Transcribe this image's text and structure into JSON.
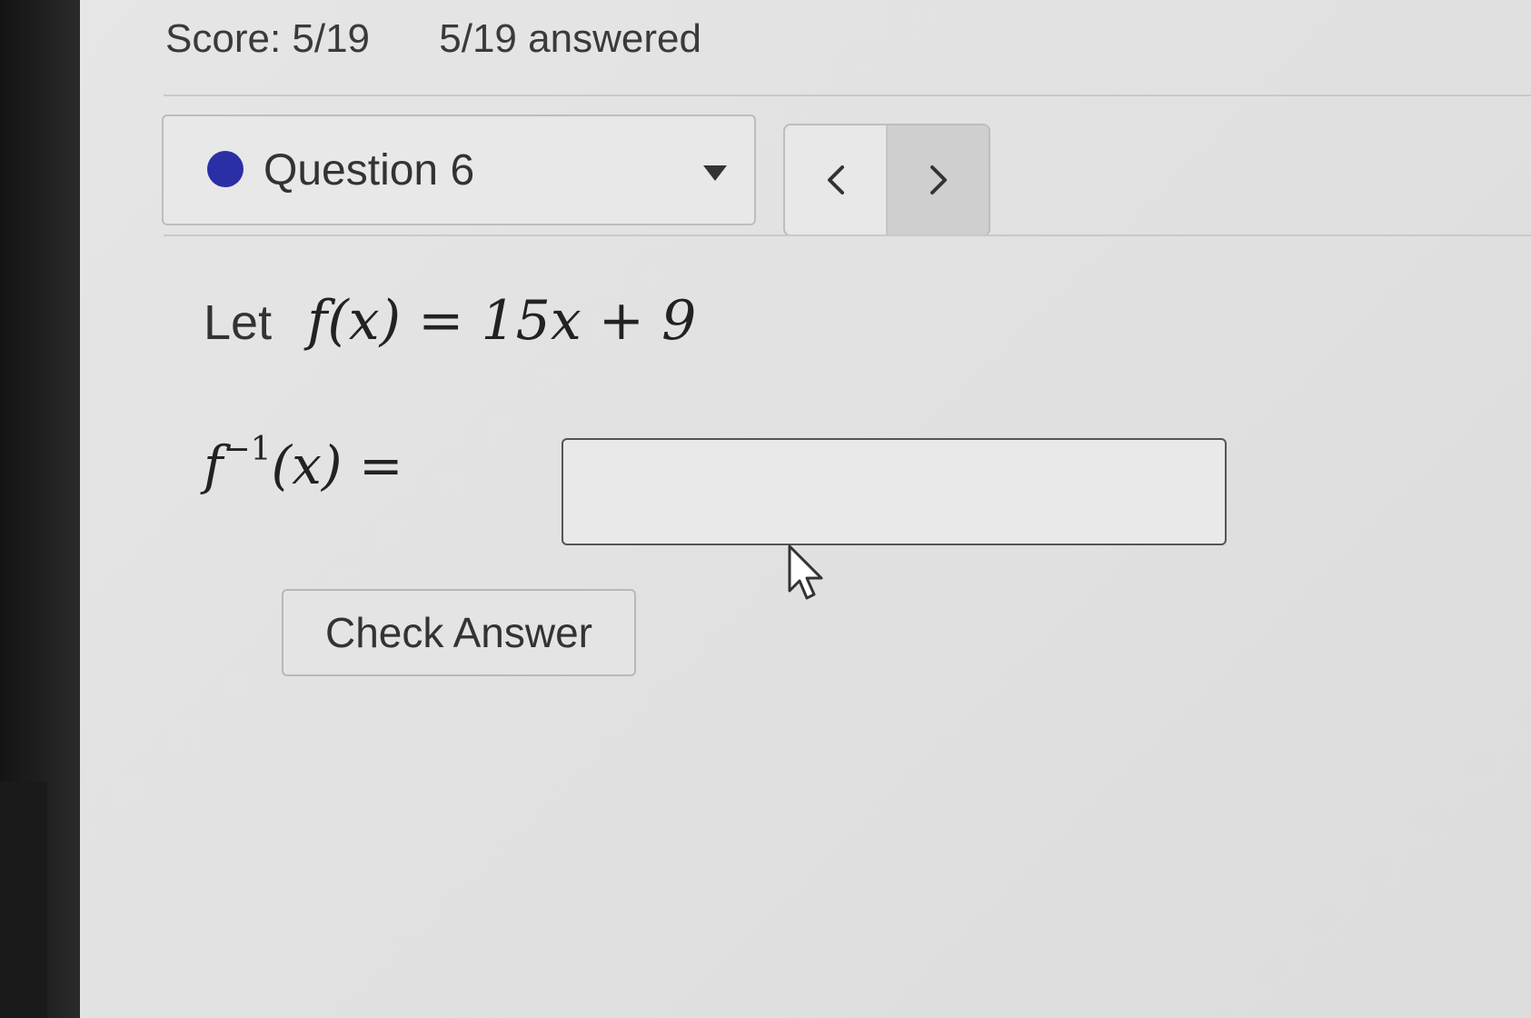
{
  "header": {
    "score": "Score: 5/19",
    "answered": "5/19 answered"
  },
  "question_selector": {
    "label": "Question 6",
    "status_color": "#2b2fa6"
  },
  "nav": {
    "prev_icon": "chevron-left-icon",
    "next_icon": "chevron-right-icon"
  },
  "question": {
    "let_word": "Let",
    "function_lhs": "f(x)",
    "equals": "=",
    "function_rhs": "15x + 9"
  },
  "prompt": {
    "lhs_base": "f",
    "lhs_sup": "−1",
    "lhs_arg": "(x)",
    "equals": "="
  },
  "answer_input": {
    "value": "",
    "placeholder": ""
  },
  "check_button": {
    "label": "Check Answer"
  }
}
